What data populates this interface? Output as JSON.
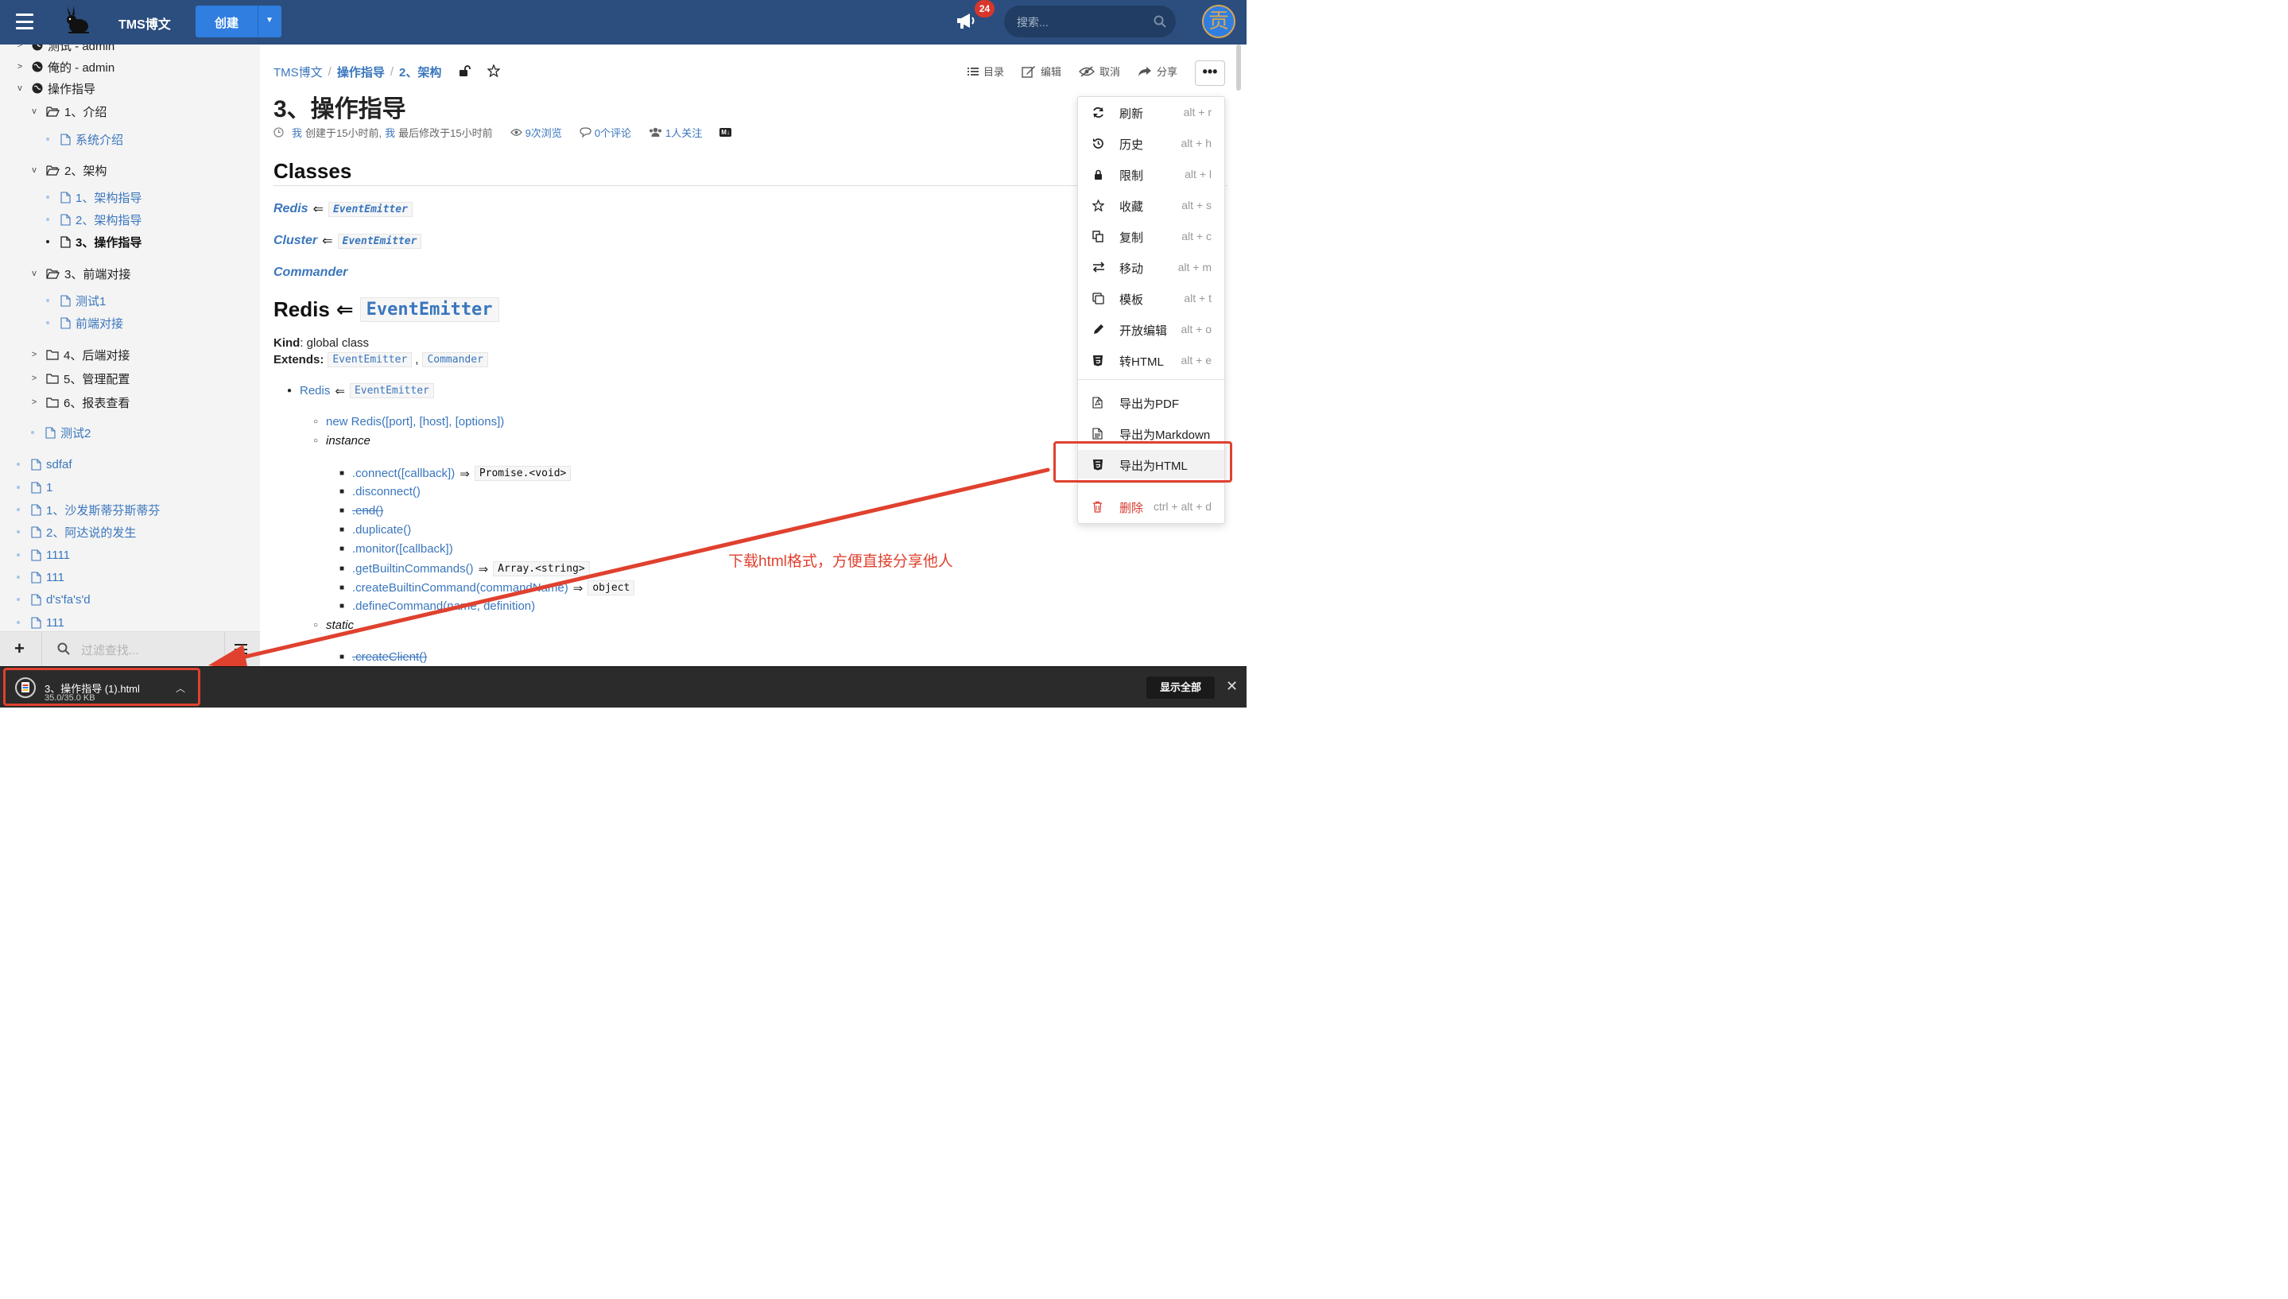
{
  "header": {
    "brand": "TMS博文",
    "create_label": "创建",
    "notify_count": "24",
    "search_placeholder": "搜索...",
    "avatar_char": "贡"
  },
  "sidebar": {
    "items": [
      {
        "label": "测试 - admin"
      },
      {
        "label": "俺的 - admin"
      },
      {
        "label": "操作指导"
      },
      {
        "label": "1、介绍"
      },
      {
        "label": "系统介绍"
      },
      {
        "label": "2、架构"
      },
      {
        "label": "1、架构指导"
      },
      {
        "label": "2、架构指导"
      },
      {
        "label": "3、操作指导"
      },
      {
        "label": "3、前端对接"
      },
      {
        "label": "测试1"
      },
      {
        "label": "前端对接"
      },
      {
        "label": "4、后端对接"
      },
      {
        "label": "5、管理配置"
      },
      {
        "label": "6、报表查看"
      },
      {
        "label": "测试2"
      },
      {
        "label": "sdfaf"
      },
      {
        "label": "1"
      },
      {
        "label": "1、沙发斯蒂芬斯蒂芬"
      },
      {
        "label": "2、阿达说的发生"
      },
      {
        "label": "1111"
      },
      {
        "label": "111"
      },
      {
        "label": "d's'fa's'd"
      },
      {
        "label": "111"
      }
    ],
    "filter_placeholder": "过滤查找..."
  },
  "breadcrumb": {
    "root": "TMS博文",
    "sep": "/",
    "level1": "操作指导",
    "level2": "2、架构"
  },
  "toolbar": {
    "toc": "目录",
    "edit": "编辑",
    "cancel": "取消",
    "share": "分享",
    "more": "•••"
  },
  "doc": {
    "title": "3、操作指导",
    "meta_me1": "我",
    "meta_created": "创建于15小时前,",
    "meta_me2": "我",
    "meta_modified": "最后修改于15小时前",
    "views": "9次浏览",
    "comments": "0个评论",
    "followers": "1人关注",
    "md_badge": "M↓"
  },
  "content": {
    "classes_heading": "Classes",
    "arrow": "⇐",
    "redis": "Redis",
    "cluster": "Cluster",
    "commander": "Commander",
    "event_emitter": "EventEmitter",
    "kind_label": "Kind",
    "kind_value": ": global class",
    "extends_label": "Extends",
    "extends_colon": ":",
    "comma": ",",
    "b_new_redis": "new Redis([port], [host], [options])",
    "b_instance": "instance",
    "b_connect": ".connect([callback])",
    "b_connect_ret": "Promise.<void>",
    "b_disconnect": ".disconnect()",
    "b_end": ".end()",
    "b_duplicate": ".duplicate()",
    "b_monitor": ".monitor([callback])",
    "b_builtin": ".getBuiltinCommands()",
    "b_builtin_ret": "Array.<string>",
    "b_create_builtin": ".createBuiltinCommand(commandName)",
    "b_create_builtin_ret": "object",
    "b_define": ".defineCommand(name, definition)",
    "b_static": "static",
    "b_create_client": ".createClient()",
    "ret_arrow": "⇒"
  },
  "dropdown": {
    "items": [
      {
        "label": "刷新",
        "key": "alt + r",
        "icon": "refresh-icon"
      },
      {
        "label": "历史",
        "key": "alt + h",
        "icon": "history-icon"
      },
      {
        "label": "限制",
        "key": "alt + l",
        "icon": "lock-icon"
      },
      {
        "label": "收藏",
        "key": "alt + s",
        "icon": "star-icon"
      },
      {
        "label": "复制",
        "key": "alt + c",
        "icon": "copy-icon"
      },
      {
        "label": "移动",
        "key": "alt + m",
        "icon": "move-icon"
      },
      {
        "label": "模板",
        "key": "alt + t",
        "icon": "template-icon"
      },
      {
        "label": "开放编辑",
        "key": "alt + o",
        "icon": "pencil-icon"
      },
      {
        "label": "转HTML",
        "key": "alt + e",
        "icon": "html5-icon"
      },
      {
        "label": "导出为PDF",
        "key": "",
        "icon": "pdf-icon"
      },
      {
        "label": "导出为Markdown",
        "key": "",
        "icon": "doc-icon"
      },
      {
        "label": "导出为HTML",
        "key": "",
        "icon": "html5-icon"
      },
      {
        "label": "删除",
        "key": "ctrl + alt + d",
        "icon": "trash-icon"
      }
    ]
  },
  "annotation": {
    "text": "下载html格式，方便直接分享他人",
    "color": "#e0412f"
  },
  "download_bar": {
    "file_name": "3、操作指导 (1).html",
    "file_size": "35.0/35.0 KB",
    "show_all": "显示全部",
    "close": "✕"
  }
}
